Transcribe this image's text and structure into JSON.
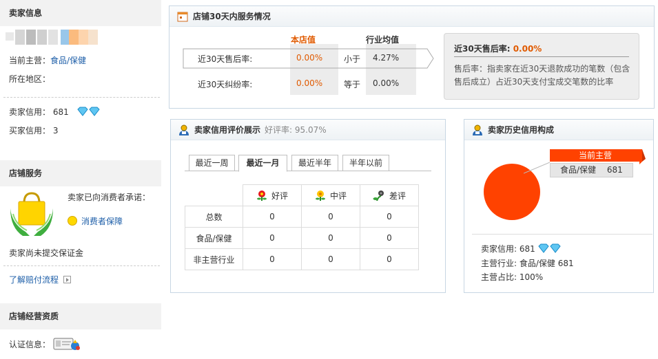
{
  "seller_info": {
    "title": "卖家信息",
    "main_business_label": "当前主营：",
    "main_business_value": "食品/保健",
    "region_label": "所在地区：",
    "seller_rating_label": "卖家信用：",
    "seller_rating_value": "681",
    "buyer_rating_label": "买家信用：",
    "buyer_rating_value": "3"
  },
  "shop_service": {
    "title": "店铺服务",
    "promise_text": "卖家已向消费者承诺：",
    "guarantee_link": "消费者保障",
    "deposit_text": "卖家尚未提交保证金",
    "process_link": "了解赔付流程"
  },
  "qualification": {
    "title": "店铺经营资质",
    "cert_label": "认证信息："
  },
  "service_30": {
    "title": "店铺30天内服务情况",
    "col_shop": "本店值",
    "col_industry": "行业均值",
    "rows": [
      {
        "label": "近30天售后率:",
        "shop": "0.00%",
        "compare": "小于",
        "industry": "4.27%"
      },
      {
        "label": "近30天纠纷率:",
        "shop": "0.00%",
        "compare": "等于",
        "industry": "0.00%"
      }
    ],
    "bubble_title": "近30天售后率:",
    "bubble_value": "0.00%",
    "bubble_desc": "售后率：指卖家在近30天退款成功的笔数（包含售后成立）占近30天支付宝成交笔数的比率"
  },
  "credit_display": {
    "title": "卖家信用评价展示",
    "rate_label": "好评率:",
    "rate_value": "95.07%",
    "tabs": [
      "最近一周",
      "最近一月",
      "最近半年",
      "半年以前"
    ],
    "active_tab": 1,
    "headers": [
      "好评",
      "中评",
      "差评"
    ],
    "rows": [
      {
        "label": "总数",
        "values": [
          "0",
          "0",
          "0"
        ]
      },
      {
        "label": "食品/保健",
        "values": [
          "0",
          "0",
          "0"
        ]
      },
      {
        "label": "非主营行业",
        "values": [
          "0",
          "0",
          "0"
        ]
      }
    ]
  },
  "history": {
    "title": "卖家历史信用构成",
    "flag_label": "当前主营",
    "tag_category": "食品/保健",
    "tag_value": "681",
    "seller_credit_label": "卖家信用:",
    "seller_credit_value": "681",
    "main_industry_label": "主营行业:",
    "main_industry_value": "食品/保健 681",
    "main_ratio_label": "主营占比:",
    "main_ratio_value": "100%",
    "chart_color": "#ff4200"
  },
  "colors": {
    "orange": "#e05a00",
    "link": "#1d5ea8",
    "diamond": "#2aa7e0"
  }
}
